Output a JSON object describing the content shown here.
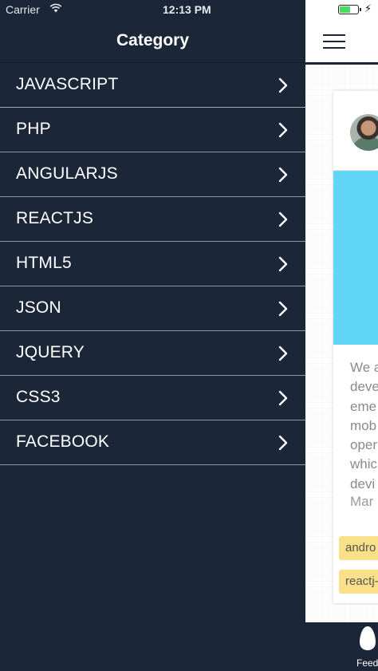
{
  "status_bar": {
    "carrier": "Carrier",
    "time": "12:13 PM",
    "battery_level": 0.6,
    "battery_color": "#4cd964",
    "charging_icon": "lightning-bolt-icon"
  },
  "drawer": {
    "title": "Category",
    "background_color": "#1b2638",
    "items": [
      {
        "label": "JAVASCRIPT"
      },
      {
        "label": "PHP"
      },
      {
        "label": "ANGULARJS"
      },
      {
        "label": "REACTJS"
      },
      {
        "label": "HTML5"
      },
      {
        "label": "JSON"
      },
      {
        "label": "JQUERY"
      },
      {
        "label": "CSS3"
      },
      {
        "label": "FACEBOOK"
      }
    ],
    "item_icon": "chevron-right-icon"
  },
  "main": {
    "menu_icon": "hamburger-menu-icon",
    "card": {
      "banner_color": "#61d6f7",
      "description_visible_fragments": [
        "We a",
        "deve",
        "eme",
        "mob",
        "oper",
        "whic",
        "devi"
      ],
      "date_fragment": "Mar",
      "tags": [
        "andro",
        "reactj-"
      ],
      "tag_color": "#fbe08a"
    }
  },
  "tabbar": {
    "feed_label": "Feed",
    "feed_icon": "egg-feed-icon"
  }
}
